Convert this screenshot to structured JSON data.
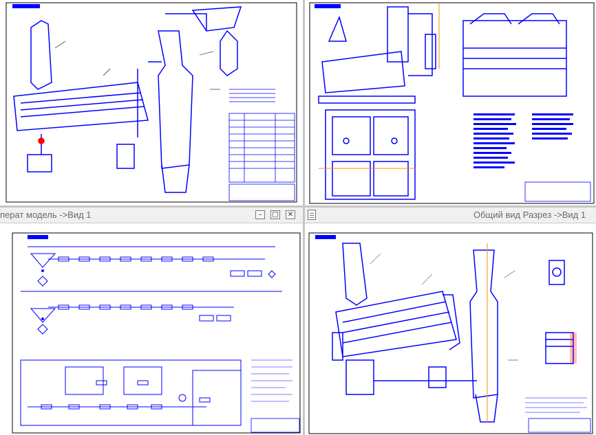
{
  "windows": {
    "bottom_left_title": "перат модель ->Вид 1",
    "bottom_right_title": "Общий вид Разрез ->Вид 1"
  },
  "controls": {
    "minimize_glyph": "–",
    "restore_glyph": "□",
    "close_glyph": "✕"
  },
  "colors": {
    "drawing_line": "#0000ff",
    "accent_line": "#ff8c00",
    "sheet_border": "#000000",
    "background": "#ffffff"
  }
}
